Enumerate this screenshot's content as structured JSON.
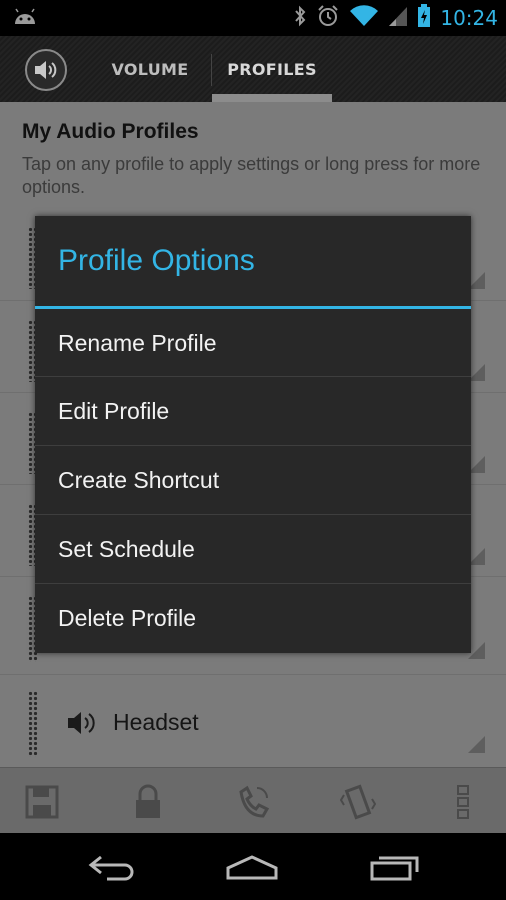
{
  "status_bar": {
    "time": "10:24"
  },
  "tabs": [
    {
      "label": "VOLUME"
    },
    {
      "label": "PROFILES"
    }
  ],
  "page": {
    "title": "My Audio Profiles",
    "subtitle": "Tap on any profile to apply settings or long press for more options.",
    "visible_profile": "Headset"
  },
  "dialog": {
    "title": "Profile Options",
    "items": [
      {
        "label": "Rename Profile"
      },
      {
        "label": "Edit Profile"
      },
      {
        "label": "Create Shortcut"
      },
      {
        "label": "Set Schedule"
      },
      {
        "label": "Delete Profile"
      }
    ]
  },
  "bottom_bar": [
    "save-icon",
    "lock-icon",
    "phone-vibrate-icon",
    "vibrate-icon",
    "overflow-menu-icon"
  ],
  "colors": {
    "accent": "#33b5e5",
    "dialog_bg": "#282828"
  }
}
